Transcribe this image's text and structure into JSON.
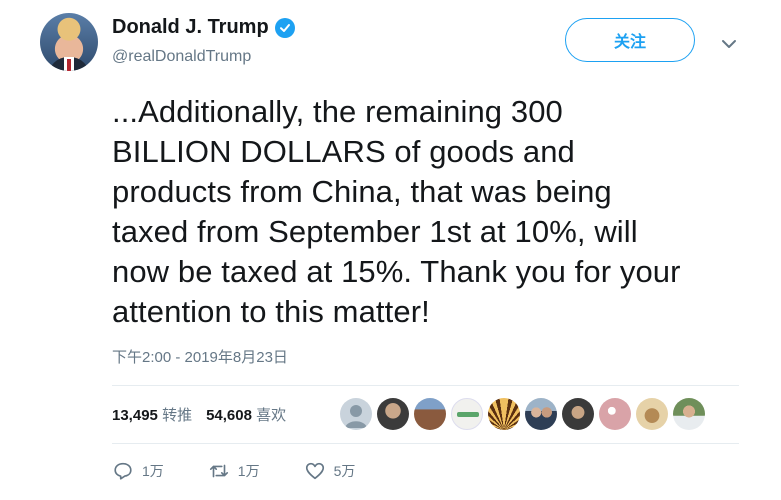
{
  "author": {
    "display_name": "Donald J. Trump",
    "handle": "@realDonaldTrump",
    "verified_icon": "verified-badge-icon",
    "avatar_icon": "profile-photo"
  },
  "follow_button": {
    "label": "关注"
  },
  "menu_icon": "chevron-down-icon",
  "tweet": {
    "lines": [
      "...Additionally, the remaining 300",
      "BILLION DOLLARS of goods and",
      "products from China, that was being",
      "taxed from September 1st at 10%, will",
      "now be taxed at 15%. Thank you for your",
      "attention to this matter!"
    ],
    "timestamp": "下午2:00 - 2019年8月23日"
  },
  "stats": {
    "retweets_count": "13,495",
    "retweets_label": "转推",
    "likes_count": "54,608",
    "likes_label": "喜欢"
  },
  "likers": [
    {
      "kind": "default-avatar",
      "color": "#c9d3dc"
    },
    {
      "kind": "photo",
      "color": "#3b3b3b"
    },
    {
      "kind": "photo",
      "color": "#8a5a3e"
    },
    {
      "kind": "logo",
      "color": "#f1f1ee"
    },
    {
      "kind": "photo",
      "color": "#c48a2a"
    },
    {
      "kind": "photo",
      "color": "#2e3e55"
    },
    {
      "kind": "photo",
      "color": "#3a3a3a"
    },
    {
      "kind": "photo",
      "color": "#d9a3a8"
    },
    {
      "kind": "photo",
      "color": "#c9a97a"
    },
    {
      "kind": "photo",
      "color": "#6f8f5a"
    }
  ],
  "actions": {
    "reply_count": "1万",
    "retweet_count": "1万",
    "like_count": "5万"
  },
  "colors": {
    "accent": "#1da1f2",
    "secondary_text": "#657786",
    "divider": "#e6ecf0"
  }
}
